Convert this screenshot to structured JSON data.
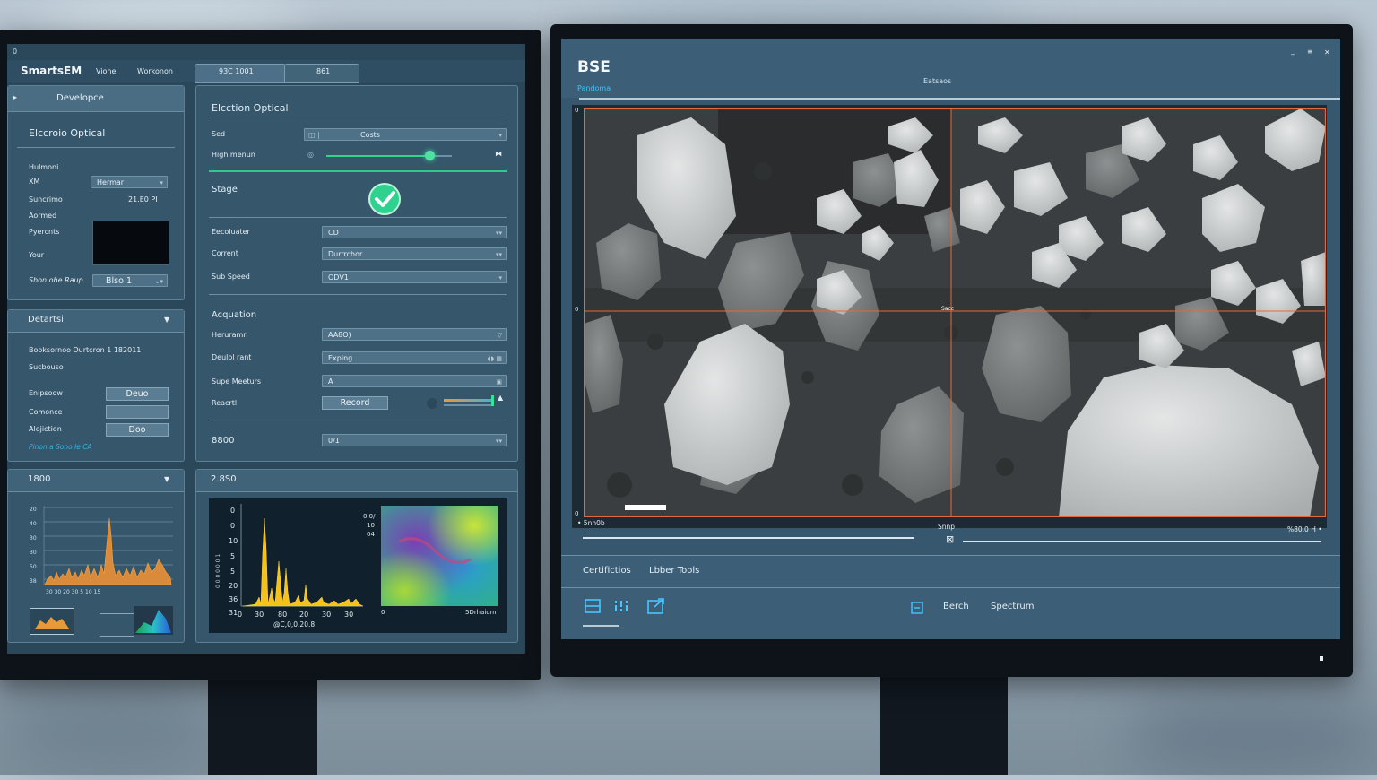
{
  "left": {
    "title_mark": "0",
    "app_name": "SmartsEM",
    "menu": [
      "Vione",
      "Workonon"
    ],
    "tabs": [
      "93C 1001",
      "861"
    ],
    "sidebar": {
      "header": "Developce",
      "section_title": "Elccroio Optical",
      "rows": [
        {
          "label": "Hulmoni",
          "value": ""
        },
        {
          "label": "XM",
          "value": "Hermar"
        },
        {
          "label": "Suncrimo",
          "value": "21.E0 PI"
        },
        {
          "label": "Aormed",
          "value": ""
        },
        {
          "label": "Pyercnts",
          "value": ""
        },
        {
          "label": "Your",
          "value": ""
        }
      ],
      "shon_label": "Shon ohe Raup",
      "shon_value": "Blso 1",
      "details": {
        "header": "Detartsi",
        "line1": "Booksornoo Durtcron 1 182011",
        "line2": "Sucbouso",
        "rows": [
          {
            "label": "Enipsoow",
            "btn": "Deuo"
          },
          {
            "label": "Comonce",
            "btn": ""
          },
          {
            "label": "Alojiction",
            "btn": "Doo"
          }
        ],
        "link": "Pinon a Sono le CA"
      },
      "mini": {
        "header": "1800",
        "yticks": [
          "20",
          "40",
          "30",
          "30",
          "50",
          "38"
        ],
        "xticks": [
          "30",
          "30",
          "20",
          "30",
          "5",
          "10",
          "15"
        ]
      }
    },
    "main": {
      "section1": "Elcction Optical",
      "sed_label": "Sed",
      "sed_value": "Costs",
      "high_label": "High menun",
      "slider_value": 0.82,
      "stage_label": "Stage",
      "rows": [
        {
          "label": "Eecoluater",
          "value": "CD"
        },
        {
          "label": "Corrent",
          "value": "Durrrchor"
        },
        {
          "label": "Sub Speed",
          "value": "ODV1"
        }
      ],
      "acq_title": "Acquation",
      "acq_rows": [
        {
          "label": "Heruramr",
          "value": "AA8O)"
        },
        {
          "label": "Deulol rant",
          "value": "Exping"
        },
        {
          "label": "Supe Meeturs",
          "value": "A"
        }
      ],
      "record_label": "Reacrtl",
      "record_button": "Record",
      "bottom_label": "8800",
      "bottom_value": "0/1",
      "spectrum": {
        "header": "2.8S0",
        "yticks": [
          "0",
          "0",
          "10",
          "5",
          "5",
          "20",
          "36",
          "31"
        ],
        "xticks": [
          "0",
          "30",
          "80",
          "20",
          "30",
          "30"
        ],
        "xlabel": "@C,0,0.20.8",
        "ylabel": "0 0 0 0 0 0 1",
        "right_ticks": [
          "0 0/",
          "10",
          "04"
        ],
        "map_left": "0",
        "map_right": "5Drhaium"
      }
    }
  },
  "right": {
    "title": "BSE",
    "subtitle": "Pandoma",
    "center_tab": "Eatsaos",
    "window_controls": [
      "_",
      "≡",
      "✕"
    ],
    "corner_marks": [
      "0",
      "0",
      "0"
    ],
    "crosshair_label": "Sacc",
    "scale_left": "• 5nn0b",
    "scale_center": "Snnp",
    "scale_right": "%80.0 H •",
    "toolbar_tabs": [
      "Certifictios",
      "Lbber Tools"
    ],
    "bottom_buttons": [
      "Berch",
      "Spectrum"
    ],
    "colors": {
      "crosshair": "#e06a3c",
      "accent": "#34c7ff"
    }
  }
}
